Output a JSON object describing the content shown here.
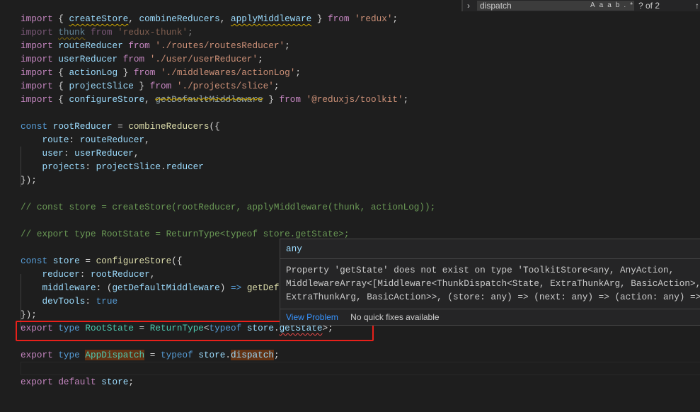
{
  "find_widget": {
    "query": "dispatch",
    "count": "? of 2",
    "options": [
      "Aa",
      "ab",
      ".*"
    ]
  },
  "code": [
    [
      [
        "import",
        "k"
      ],
      [
        " { ",
        "p"
      ],
      [
        "createStore",
        "v w"
      ],
      [
        ", ",
        "p"
      ],
      [
        "combineReducers",
        "v"
      ],
      [
        ", ",
        "p"
      ],
      [
        "applyMiddleware",
        "v w"
      ],
      [
        " } ",
        "p"
      ],
      [
        "from",
        "k"
      ],
      [
        " ",
        "p"
      ],
      [
        "'redux'",
        "s"
      ],
      [
        ";",
        "p"
      ]
    ],
    [
      [
        "import",
        "k dim"
      ],
      [
        " ",
        "p"
      ],
      [
        "thunk",
        "v w dim"
      ],
      [
        " ",
        "p"
      ],
      [
        "from",
        "k dim"
      ],
      [
        " ",
        "p"
      ],
      [
        "'redux-thunk'",
        "s dim"
      ],
      [
        ";",
        "p dim"
      ]
    ],
    [
      [
        "import",
        "k"
      ],
      [
        " ",
        "p"
      ],
      [
        "routeReducer",
        "v"
      ],
      [
        " ",
        "p"
      ],
      [
        "from",
        "k"
      ],
      [
        " ",
        "p"
      ],
      [
        "'./routes/routesReducer'",
        "s"
      ],
      [
        ";",
        "p"
      ]
    ],
    [
      [
        "import",
        "k"
      ],
      [
        " ",
        "p"
      ],
      [
        "userReducer",
        "v"
      ],
      [
        " ",
        "p"
      ],
      [
        "from",
        "k"
      ],
      [
        " ",
        "p"
      ],
      [
        "'./user/userReducer'",
        "s"
      ],
      [
        ";",
        "p"
      ]
    ],
    [
      [
        "import",
        "k"
      ],
      [
        " { ",
        "p"
      ],
      [
        "actionLog",
        "v"
      ],
      [
        " } ",
        "p"
      ],
      [
        "from",
        "k"
      ],
      [
        " ",
        "p"
      ],
      [
        "'./middlewares/actionLog'",
        "s"
      ],
      [
        ";",
        "p"
      ]
    ],
    [
      [
        "import",
        "k"
      ],
      [
        " { ",
        "p"
      ],
      [
        "projectSlice",
        "v"
      ],
      [
        " } ",
        "p"
      ],
      [
        "from",
        "k"
      ],
      [
        " ",
        "p"
      ],
      [
        "'./projects/slice'",
        "s"
      ],
      [
        ";",
        "p"
      ]
    ],
    [
      [
        "import",
        "k"
      ],
      [
        " { ",
        "p"
      ],
      [
        "configureStore",
        "v"
      ],
      [
        ", ",
        "p"
      ],
      [
        "getDefaultMiddleware",
        "x"
      ],
      [
        " } ",
        "p"
      ],
      [
        "from",
        "k"
      ],
      [
        " ",
        "p"
      ],
      [
        "'@reduxjs/toolkit'",
        "s"
      ],
      [
        ";",
        "p"
      ]
    ],
    [],
    [
      [
        "const",
        "b"
      ],
      [
        " ",
        "p"
      ],
      [
        "rootReducer",
        "v"
      ],
      [
        " = ",
        "p"
      ],
      [
        "combineReducers",
        "f"
      ],
      [
        "({",
        "p"
      ]
    ],
    [
      [
        "    route",
        "v"
      ],
      [
        ": ",
        "p"
      ],
      [
        "routeReducer",
        "v"
      ],
      [
        ",",
        "p"
      ]
    ],
    [
      [
        "    user",
        "v"
      ],
      [
        ": ",
        "p"
      ],
      [
        "userReducer",
        "v"
      ],
      [
        ",",
        "p"
      ]
    ],
    [
      [
        "    projects",
        "v"
      ],
      [
        ": ",
        "p"
      ],
      [
        "projectSlice",
        "v"
      ],
      [
        ".",
        "p"
      ],
      [
        "reducer",
        "v"
      ]
    ],
    [
      [
        "});",
        "p"
      ]
    ],
    [],
    [
      [
        "// const store = createStore(rootReducer, applyMiddleware(thunk, actionLog));",
        "c"
      ]
    ],
    [],
    [
      [
        "// export type RootState = ReturnType<typeof store.getState>;",
        "c"
      ]
    ],
    [],
    [
      [
        "const",
        "b"
      ],
      [
        " ",
        "p"
      ],
      [
        "store",
        "v"
      ],
      [
        " = ",
        "p"
      ],
      [
        "configureStore",
        "f"
      ],
      [
        "({",
        "p"
      ]
    ],
    [
      [
        "    reducer",
        "v"
      ],
      [
        ": ",
        "p"
      ],
      [
        "rootReducer",
        "v"
      ],
      [
        ",",
        "p"
      ]
    ],
    [
      [
        "    middleware",
        "v"
      ],
      [
        ": (",
        "p"
      ],
      [
        "getDefaultMiddleware",
        "v"
      ],
      [
        ") ",
        "p"
      ],
      [
        "=>",
        "b"
      ],
      [
        " ",
        "p"
      ],
      [
        "getDef",
        "f"
      ]
    ],
    [
      [
        "    devTools",
        "v"
      ],
      [
        ": ",
        "p"
      ],
      [
        "true",
        "b"
      ]
    ],
    [
      [
        "});",
        "p"
      ]
    ],
    [
      [
        "export",
        "k"
      ],
      [
        " ",
        "p"
      ],
      [
        "type",
        "b"
      ],
      [
        " ",
        "p"
      ],
      [
        "RootState",
        "t"
      ],
      [
        " = ",
        "p"
      ],
      [
        "ReturnType",
        "t"
      ],
      [
        "<",
        "p"
      ],
      [
        "typeof",
        "b"
      ],
      [
        " ",
        "p"
      ],
      [
        "store",
        "v"
      ],
      [
        ".",
        "p"
      ],
      [
        "getState",
        "v e"
      ],
      [
        ">;",
        "p"
      ]
    ],
    [],
    [
      [
        "export",
        "k"
      ],
      [
        " ",
        "p"
      ],
      [
        "type",
        "b"
      ],
      [
        " ",
        "p"
      ],
      [
        "AppDispatch",
        "t h"
      ],
      [
        " = ",
        "p"
      ],
      [
        "typeof",
        "b"
      ],
      [
        " ",
        "p"
      ],
      [
        "store",
        "v"
      ],
      [
        ".",
        "p"
      ],
      [
        "dispatch",
        "v h"
      ],
      [
        ";",
        "p"
      ]
    ],
    [],
    [
      [
        "export",
        "k"
      ],
      [
        " ",
        "p"
      ],
      [
        "default",
        "k"
      ],
      [
        " ",
        "p"
      ],
      [
        "store",
        "v"
      ],
      [
        ";",
        "p"
      ]
    ]
  ],
  "hover": {
    "signature": "any",
    "message": [
      "Property 'getState' does not exist on type 'ToolkitStore<any, AnyAction,",
      "MiddlewareArray<[Middleware<ThunkDispatch<State, ExtraThunkArg, BasicAction>,",
      "ExtraThunkArg, BasicAction>>, (store: any) => (next: any) => (action: any) =>"
    ],
    "view_problem": "View Problem",
    "no_fixes": "No quick fixes available"
  },
  "colors": {
    "background": "#1e1e1e",
    "highlight_box": "#e8201a",
    "error_squiggle": "#f14c4c",
    "warning_squiggle": "#cca700"
  }
}
